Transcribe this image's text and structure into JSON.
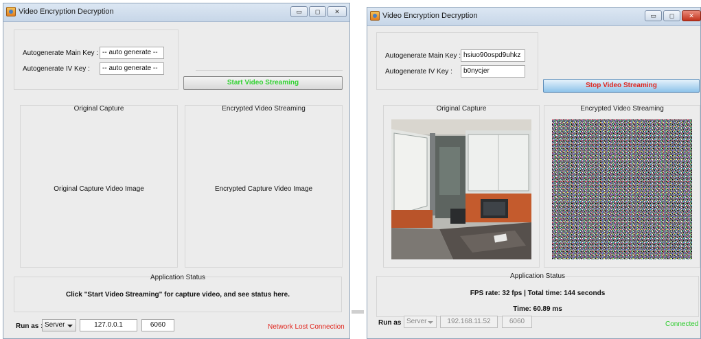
{
  "window1": {
    "title": "Video Encryption Decryption",
    "main_key_label": "Autogenerate Main Key :",
    "main_key_value": "-- auto generate  --",
    "iv_key_label": "Autogenerate IV Key    :",
    "iv_key_value": "-- auto generate  --",
    "stream_button": "Start Video Streaming",
    "original_title": "Original Capture",
    "original_placeholder": "Original Capture Video Image",
    "encrypted_title": "Encrypted Video Streaming",
    "encrypted_placeholder": "Encrypted Capture Video Image",
    "status_title": "Application Status",
    "status_message": "Click \"Start Video Streaming\" for capture video, and see status here.",
    "run_as_label": "Run as :",
    "run_as_value": "Server",
    "ip_value": "127.0.0.1",
    "port_value": "6060",
    "network_status": "Network Lost Connection"
  },
  "window2": {
    "title": "Video Encryption Decryption",
    "main_key_label": "Autogenerate Main Key :",
    "main_key_value": "hsiuo90ospd9uhkz",
    "iv_key_label": "Autogenerate IV Key    :",
    "iv_key_value": "b0nycjer",
    "stream_button": "Stop Video Streaming",
    "original_title": "Original Capture",
    "encrypted_title": "Encrypted Video Streaming",
    "status_title": "Application Status",
    "status_line1": "FPS rate: 32 fps | Total time: 144 seconds",
    "status_line2": "Time: 60.89 ms",
    "run_as_label": "Run as :",
    "run_as_value": "Server",
    "ip_value": "192.168.11.52",
    "port_value": "6060",
    "network_status": "Connected"
  },
  "colors": {
    "start_text": "#32d232",
    "stop_text": "#e0261e",
    "lost": "#e0261e",
    "connected": "#2ecc2e"
  },
  "icons": {
    "minimize": "minimize-icon",
    "maximize": "maximize-icon",
    "close": "close-icon",
    "dropdown": "chevron-down-icon"
  }
}
